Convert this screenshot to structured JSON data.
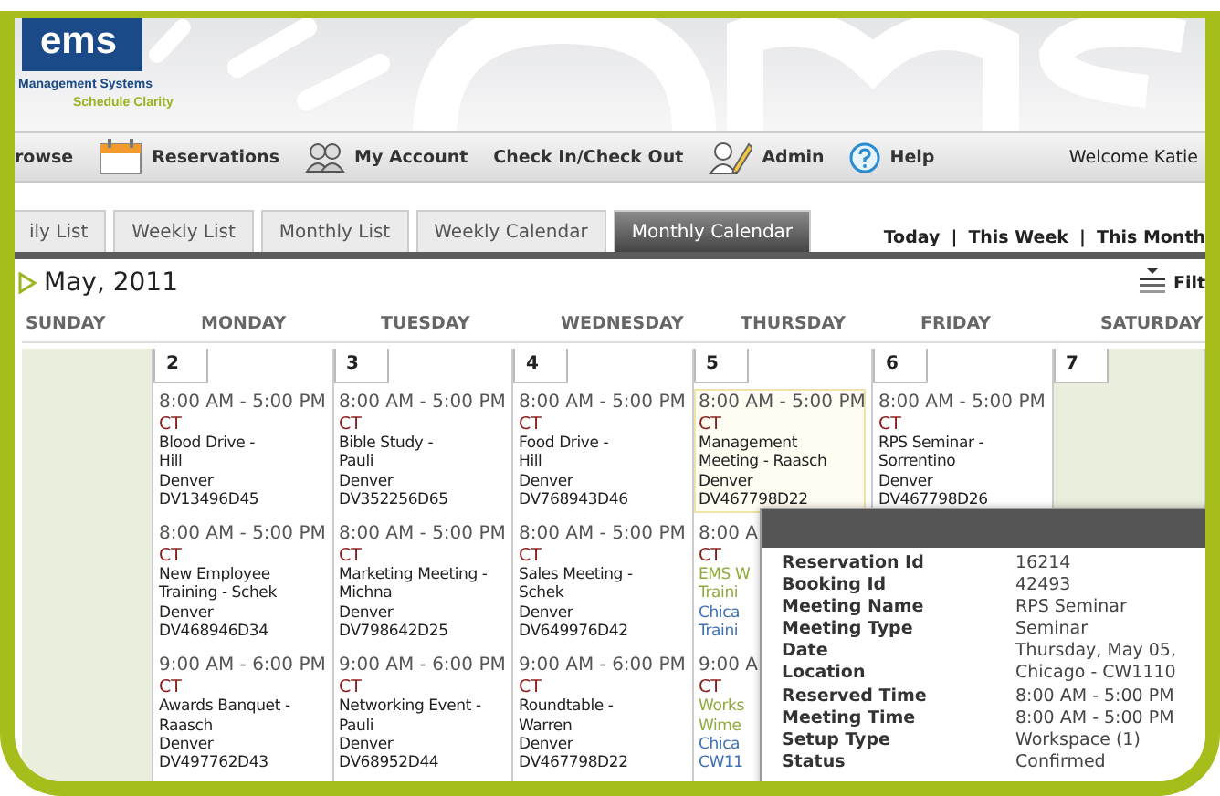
{
  "logo": {
    "mark": "ems",
    "line1": "Management Systems",
    "line2": "Schedule Clarity"
  },
  "nav": {
    "items": [
      {
        "label": "rowse",
        "kind": "plain"
      },
      {
        "label": "Reservations",
        "kind": "calendar"
      },
      {
        "label": "My Account",
        "kind": "people"
      },
      {
        "label": "Check In/Check Out",
        "kind": "plain"
      },
      {
        "label": "Admin",
        "kind": "pen"
      },
      {
        "label": "Help",
        "kind": "help"
      }
    ],
    "welcome": "Welcome Katie"
  },
  "view_tabs": [
    {
      "label": "ily List",
      "selected": false
    },
    {
      "label": "Weekly List",
      "selected": false
    },
    {
      "label": "Monthly List",
      "selected": false
    },
    {
      "label": "Weekly Calendar",
      "selected": false
    },
    {
      "label": "Monthly Calendar",
      "selected": true
    }
  ],
  "quick_links": [
    {
      "label": "Today",
      "separator": "|"
    },
    {
      "label": "This Week",
      "separator": "|"
    },
    {
      "label": "This Month"
    }
  ],
  "calendar": {
    "title": "May, 2011",
    "filter_label": "Filt",
    "days": [
      "SUNDAY",
      "MONDAY",
      "TUESDAY",
      "WEDNESDAY",
      "THURSDAY",
      "FRIDAY",
      "SATURDAY"
    ],
    "cells": [
      {
        "kind": "weekend"
      },
      {
        "kind": "weekday",
        "date": "2",
        "events": [
          {
            "kind": "standard",
            "highlighted": false,
            "time": "8:00 AM - 5:00 PM",
            "zone": "CT",
            "name_lines": [
              "Blood Drive -",
              "Hill"
            ],
            "location_lines": [
              "Denver",
              "DV13496D45"
            ]
          },
          {
            "kind": "standard",
            "highlighted": false,
            "time": "8:00 AM - 5:00 PM",
            "zone": "CT",
            "name_lines": [
              "New Employee",
              "Training - Schek"
            ],
            "location_lines": [
              "Denver",
              "DV468946D34"
            ]
          },
          {
            "kind": "standard",
            "highlighted": false,
            "time": "9:00 AM - 6:00 PM",
            "zone": "CT",
            "name_lines": [
              "Awards Banquet -",
              "Raasch"
            ],
            "location_lines": [
              "Denver",
              "DV497762D43"
            ]
          }
        ]
      },
      {
        "kind": "weekday",
        "date": "3",
        "events": [
          {
            "kind": "standard",
            "highlighted": false,
            "time": "8:00 AM - 5:00 PM",
            "zone": "CT",
            "name_lines": [
              "Bible Study -",
              "Pauli"
            ],
            "location_lines": [
              "Denver",
              "DV352256D65"
            ]
          },
          {
            "kind": "standard",
            "highlighted": false,
            "time": "8:00 AM - 5:00 PM",
            "zone": "CT",
            "name_lines": [
              "Marketing Meeting -",
              "Michna"
            ],
            "location_lines": [
              "Denver",
              "DV798642D25"
            ]
          },
          {
            "kind": "standard",
            "highlighted": false,
            "time": "9:00 AM - 6:00 PM",
            "zone": "CT",
            "name_lines": [
              "Networking Event -",
              "Pauli"
            ],
            "location_lines": [
              "Denver",
              "DV68952D44"
            ]
          }
        ]
      },
      {
        "kind": "weekday",
        "date": "4",
        "events": [
          {
            "kind": "standard",
            "highlighted": false,
            "time": "8:00 AM - 5:00 PM",
            "zone": "CT",
            "name_lines": [
              "Food Drive -",
              "Hill"
            ],
            "location_lines": [
              "Denver",
              "DV768943D46"
            ]
          },
          {
            "kind": "standard",
            "highlighted": false,
            "time": "8:00 AM - 5:00 PM",
            "zone": "CT",
            "name_lines": [
              "Sales Meeting -",
              "Schek"
            ],
            "location_lines": [
              "Denver",
              "DV649976D42"
            ]
          },
          {
            "kind": "standard",
            "highlighted": false,
            "time": "9:00 AM - 6:00 PM",
            "zone": "CT",
            "name_lines": [
              "Roundtable -",
              "Warren"
            ],
            "location_lines": [
              "Denver",
              "DV467798D22"
            ]
          }
        ]
      },
      {
        "kind": "weekday",
        "date": "5",
        "events": [
          {
            "kind": "standard",
            "highlighted": true,
            "time": "8:00 AM - 5:00 PM",
            "zone": "CT",
            "name_lines": [
              "Management",
              "Meeting - Raasch"
            ],
            "location_lines": [
              "Denver",
              "DV467798D22"
            ]
          },
          {
            "kind": "web",
            "highlighted": false,
            "time": "8:00 A",
            "zone": "CT",
            "name_lines": [
              "EMS W",
              "Traini"
            ],
            "location_lines": [
              "Chica",
              "Traini"
            ]
          },
          {
            "kind": "web",
            "highlighted": false,
            "time": "9:00 A",
            "zone": "CT",
            "name_lines": [
              "Works",
              "Wime"
            ],
            "location_lines": [
              "Chica",
              "CW11"
            ]
          }
        ]
      },
      {
        "kind": "weekday",
        "date": "6",
        "events": [
          {
            "kind": "standard",
            "highlighted": false,
            "time": "8:00 AM - 5:00 PM",
            "zone": "CT",
            "name_lines": [
              "RPS Seminar -",
              "Sorrentino"
            ],
            "location_lines": [
              "Denver",
              "DV467798D26"
            ]
          }
        ]
      },
      {
        "kind": "weekend",
        "date": "7"
      }
    ]
  },
  "popup": {
    "rows": [
      {
        "label": "Reservation Id",
        "value": "16214"
      },
      {
        "label": "Booking Id",
        "value": "42493"
      },
      {
        "label": "Meeting Name",
        "value": "RPS Seminar"
      },
      {
        "label": "Meeting Type",
        "value": "Seminar"
      },
      {
        "label": "Date",
        "value": "Thursday, May 05,"
      },
      {
        "label": "Location",
        "value": "Chicago - CW1110"
      },
      {
        "label": "Reserved Time",
        "value": "8:00 AM - 5:00 PM"
      },
      {
        "label": "Meeting Time",
        "value": "8:00 AM - 5:00 PM"
      },
      {
        "label": "Setup Type",
        "value": "Workspace (1)"
      },
      {
        "label": "Status",
        "value": "Confirmed"
      }
    ]
  }
}
